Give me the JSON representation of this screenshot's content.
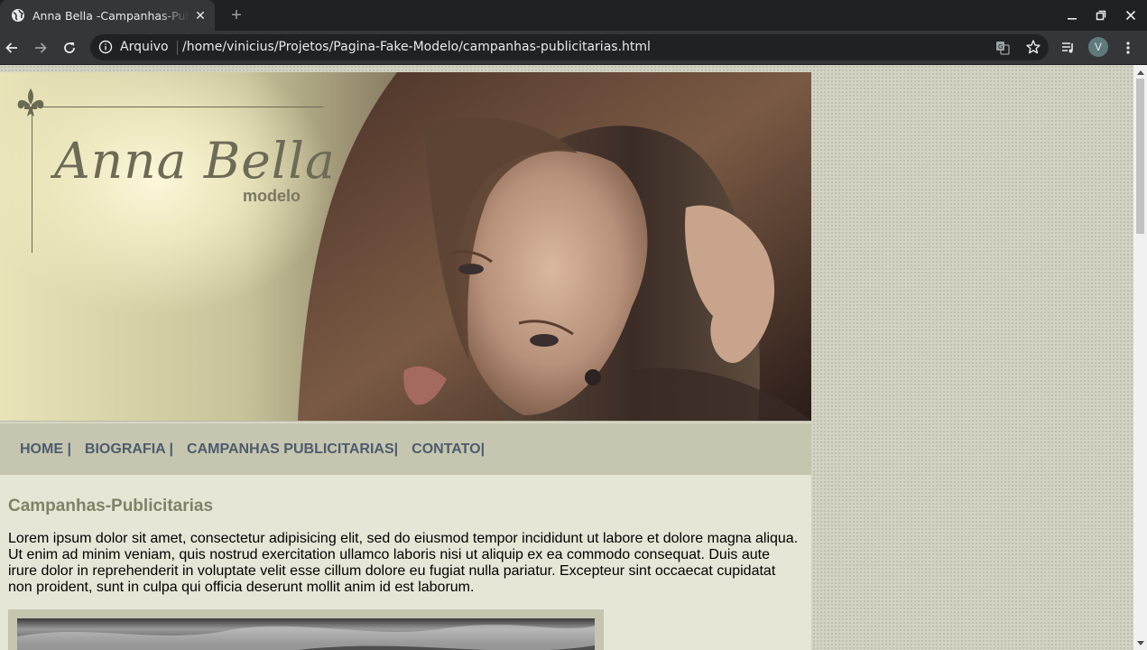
{
  "browser": {
    "tab_title": "Anna Bella -Campanhas-Publicitarias",
    "address_label": "Arquivo",
    "url": "/home/vinicius/Projetos/Pagina-Fake-Modelo/campanhas-publicitarias.html",
    "profile_initial": "V"
  },
  "header": {
    "brand": "Anna Bella",
    "brand_sub": "modelo"
  },
  "nav": {
    "items": [
      {
        "label": "HOME |"
      },
      {
        "label": "BIOGRAFIA |"
      },
      {
        "label": "CAMPANHAS PUBLICITARIAS|"
      },
      {
        "label": "CONTATO|"
      }
    ]
  },
  "main": {
    "heading": "Campanhas-Publicitarias",
    "paragraph": "Lorem ipsum dolor sit amet, consectetur adipisicing elit, sed do eiusmod tempor incididunt ut labore et dolore magna aliqua. Ut enim ad minim veniam, quis nostrud exercitation ullamco laboris nisi ut aliquip ex ea commodo consequat. Duis aute irure dolor in reprehenderit in voluptate velit esse cillum dolore eu fugiat nulla pariatur. Excepteur sint occaecat cupidatat non proident, sunt in culpa qui officia deserunt mollit anim id est laborum."
  },
  "colors": {
    "nav_text": "#4d5b6e",
    "heading": "#818168",
    "page_bg": "#e6e6d6",
    "nav_bg": "#c6c6b0"
  }
}
